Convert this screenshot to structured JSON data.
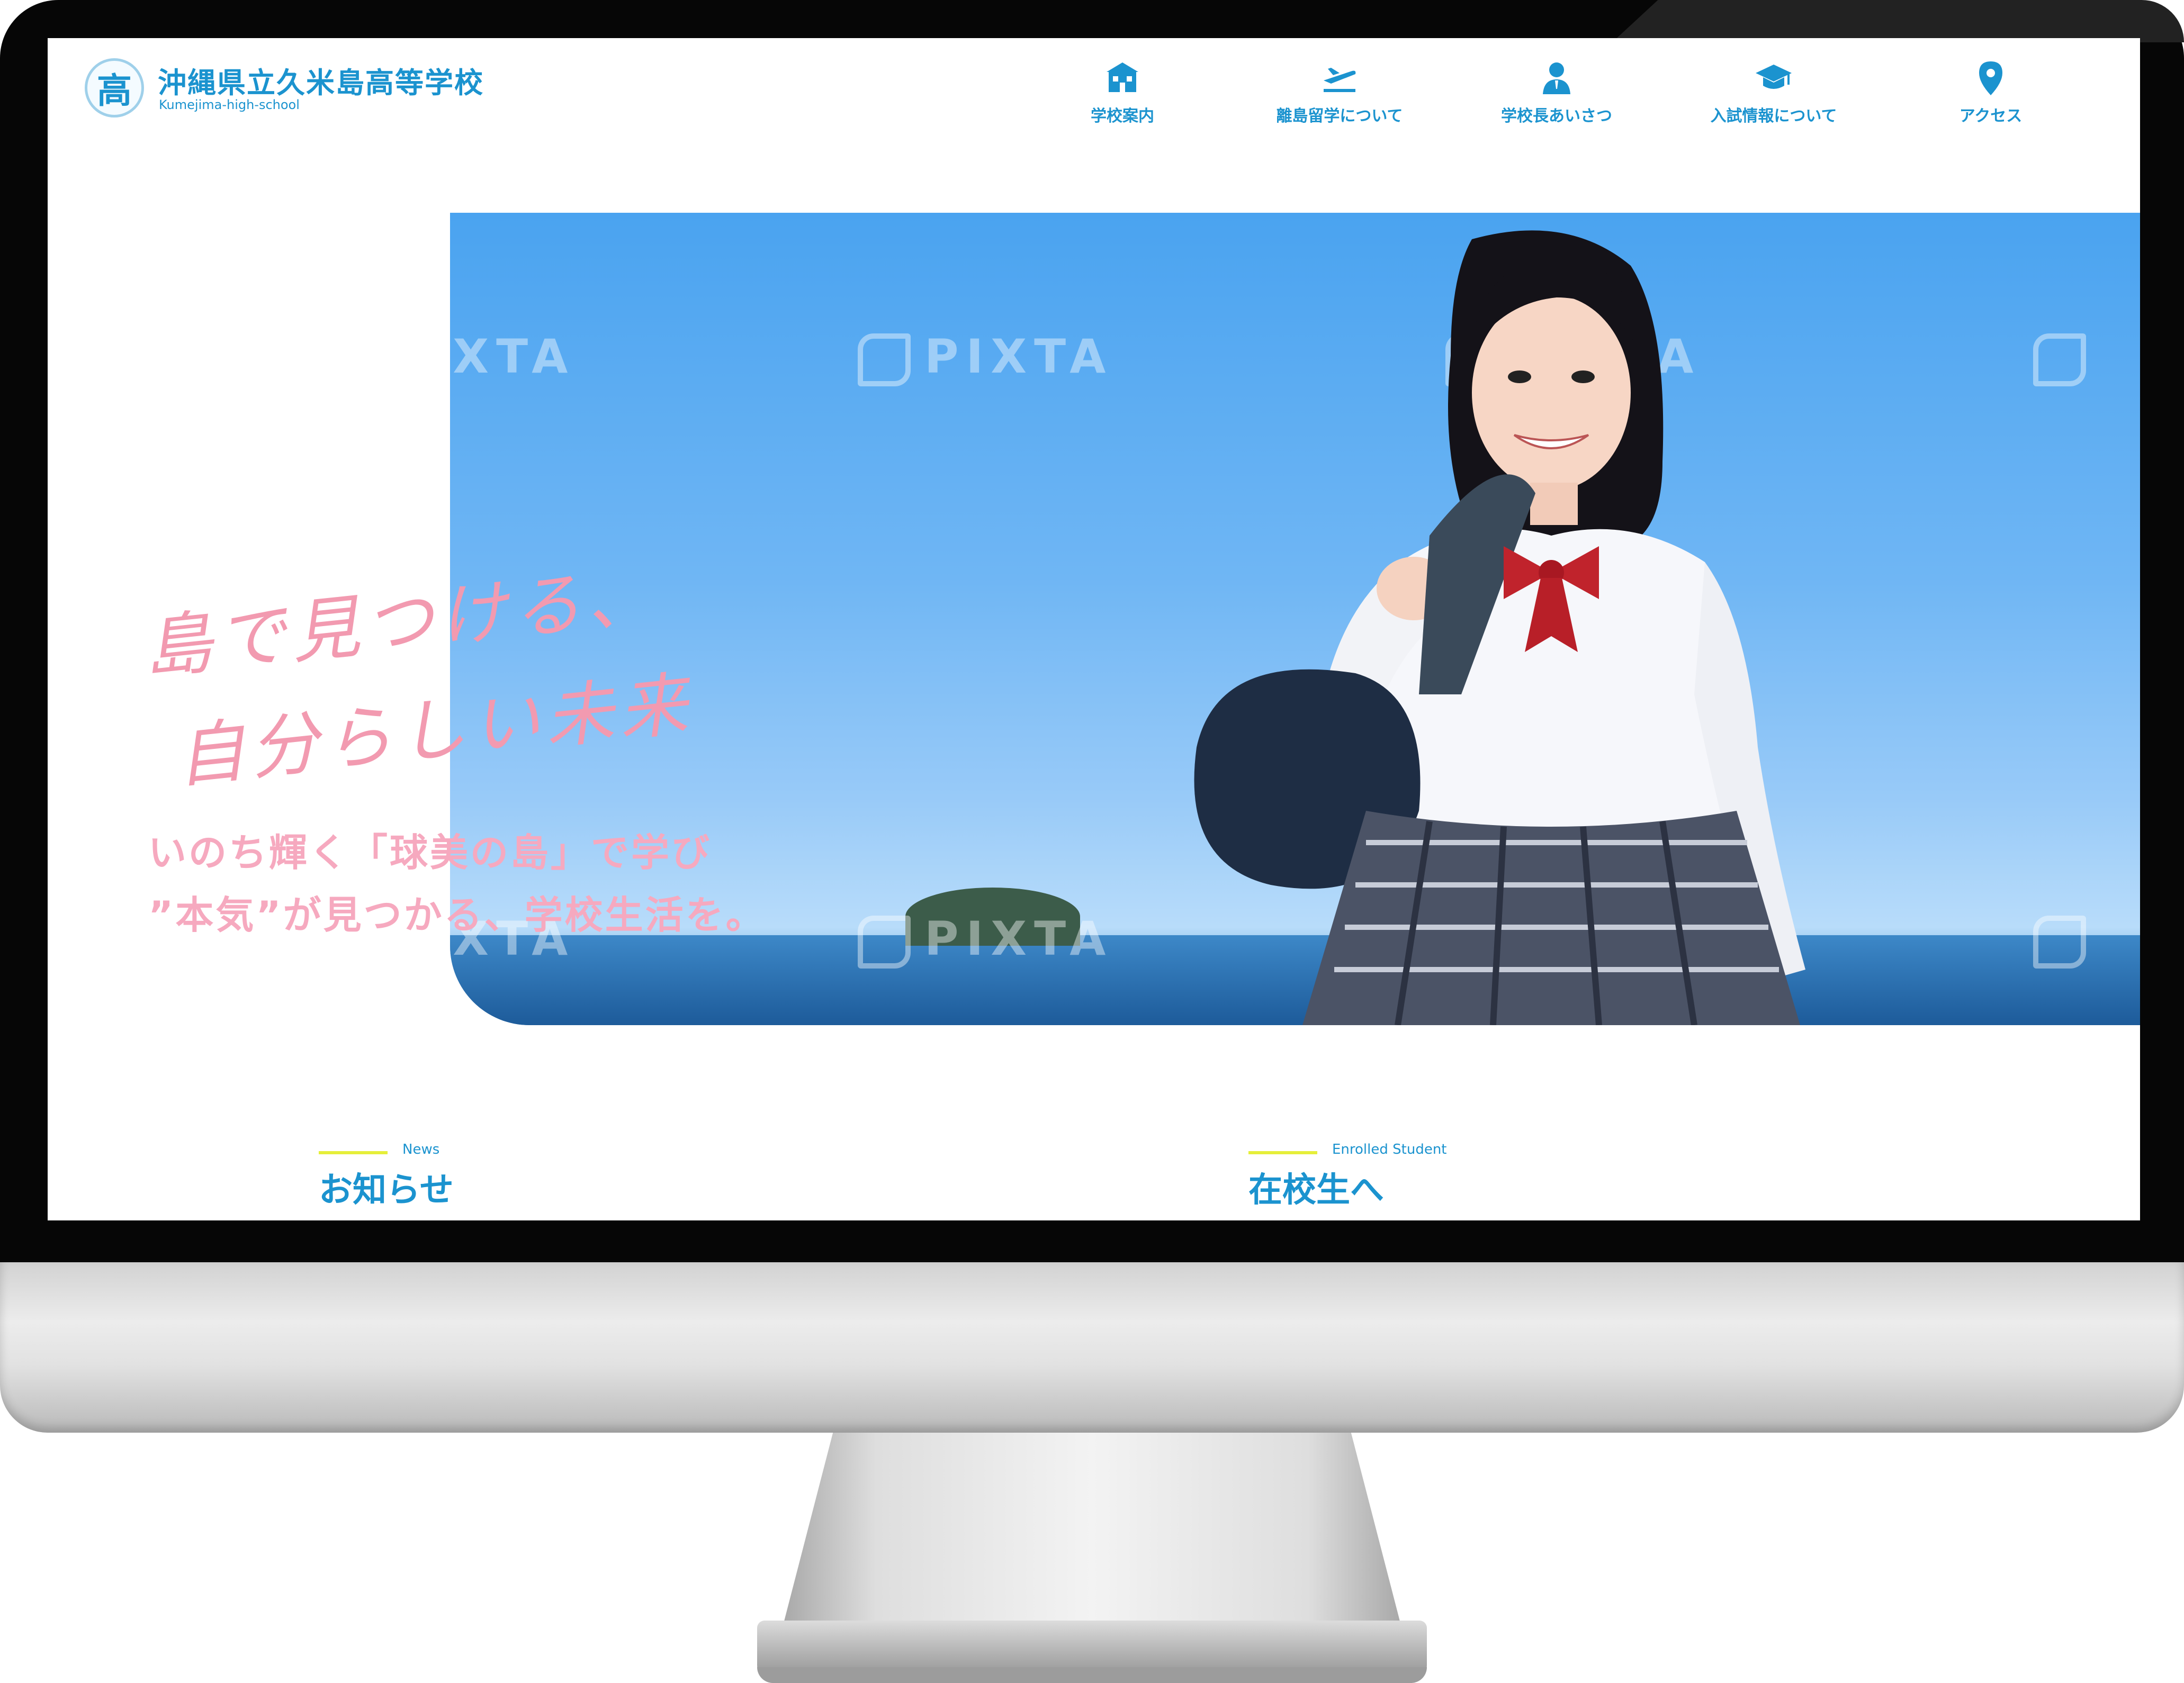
{
  "school": {
    "emblem": "高",
    "name": "沖縄県立久米島高等学校",
    "name_en": "Kumejima-high-school"
  },
  "nav": [
    {
      "label": "学校案内",
      "icon": "school-building-icon"
    },
    {
      "label": "離島留学について",
      "icon": "airplane-icon"
    },
    {
      "label": "学校長あいさつ",
      "icon": "principal-person-icon"
    },
    {
      "label": "入試情報について",
      "icon": "graduation-cap-icon"
    },
    {
      "label": "アクセス",
      "icon": "location-pin-icon"
    }
  ],
  "hero": {
    "catch_line1": "島で見つける、",
    "catch_line2": "自分らしい未来",
    "sub_line1": "いのち輝く「球美の島」で学び",
    "sub_line2": "”本気”が見つかる、学校生活を。",
    "watermark": "PIXTA",
    "sky_color": "#4aa3f0"
  },
  "sections": {
    "news": {
      "en": "News",
      "jp": "お知らせ"
    },
    "students": {
      "en": "Enrolled Student",
      "jp": "在校生へ"
    }
  },
  "colors": {
    "brand_blue": "#1b93cf",
    "accent_pink": "#f29ab0",
    "underline_yellow": "#e6ef3a"
  }
}
